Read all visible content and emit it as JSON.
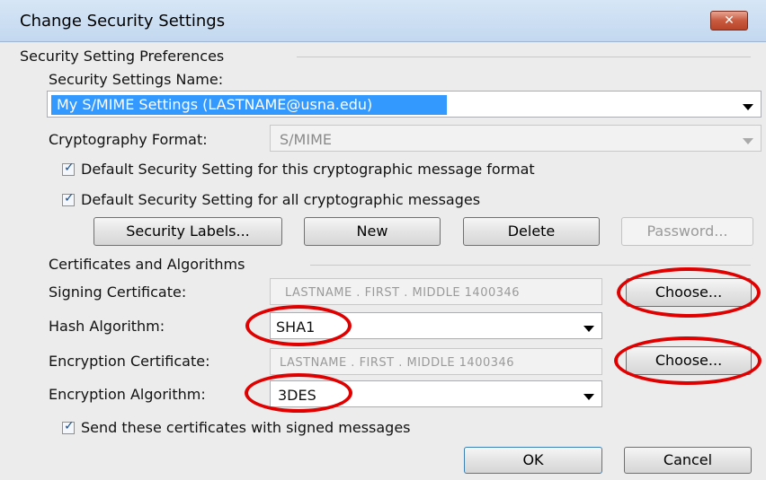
{
  "window": {
    "title": "Change Security Settings",
    "close_label": "✕"
  },
  "preferences": {
    "group_label": "Security Setting Preferences",
    "name_label": "Security Settings Name:",
    "name_value": "My S/MIME Settings (LASTNAME@usna.edu)",
    "format_label": "Cryptography Format:",
    "format_value": "S/MIME",
    "checkbox_default_format": "Default Security Setting for this cryptographic message format",
    "checkbox_default_all": "Default Security Setting for all cryptographic messages",
    "buttons": {
      "security_labels": "Security Labels...",
      "new": "New",
      "delete": "Delete",
      "password": "Password..."
    }
  },
  "certificates": {
    "group_label": "Certificates and Algorithms",
    "signing_label": "Signing Certificate:",
    "signing_value": "LASTNAME . FIRST . MIDDLE 1400346",
    "hash_label": "Hash Algorithm:",
    "hash_value": "SHA1",
    "encryption_label": "Encryption Certificate:",
    "encryption_value": "LASTNAME . FIRST . MIDDLE 1400346",
    "enc_alg_label": "Encryption Algorithm:",
    "enc_alg_value": "3DES",
    "choose_label": "Choose...",
    "send_certs": "Send these certificates with signed messages"
  },
  "footer": {
    "ok": "OK",
    "cancel": "Cancel"
  },
  "annotation_color": "#e00000"
}
